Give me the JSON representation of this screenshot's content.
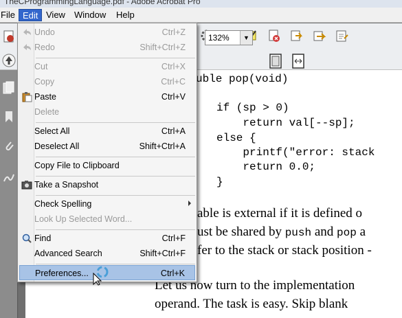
{
  "window": {
    "title": "TheCProgrammingLanguage.pdf - Adobe Acrobat Pro"
  },
  "menubar": {
    "items": [
      "File",
      "Edit",
      "View",
      "Window",
      "Help"
    ],
    "active": "Edit"
  },
  "toolbar": {
    "zoom": "132%"
  },
  "edit_menu": {
    "items": [
      {
        "label": "Undo",
        "shortcut": "Ctrl+Z",
        "enabled": false,
        "icon": "undo-icon"
      },
      {
        "label": "Redo",
        "shortcut": "Shift+Ctrl+Z",
        "enabled": false,
        "icon": "redo-icon"
      },
      {
        "label": "Cut",
        "shortcut": "Ctrl+X",
        "enabled": false
      },
      {
        "label": "Copy",
        "shortcut": "Ctrl+C",
        "enabled": false
      },
      {
        "label": "Paste",
        "shortcut": "Ctrl+V",
        "enabled": true,
        "icon": "paste-icon"
      },
      {
        "label": "Delete",
        "shortcut": "",
        "enabled": false
      },
      {
        "label": "Select All",
        "shortcut": "Ctrl+A",
        "enabled": true
      },
      {
        "label": "Deselect All",
        "shortcut": "Shift+Ctrl+A",
        "enabled": true
      },
      {
        "label": "Copy File to Clipboard",
        "shortcut": "",
        "enabled": true
      },
      {
        "label": "Take a Snapshot",
        "shortcut": "",
        "enabled": true,
        "icon": "camera-icon"
      },
      {
        "label": "Check Spelling",
        "shortcut": "",
        "enabled": true,
        "submenu": true
      },
      {
        "label": "Look Up Selected Word...",
        "shortcut": "",
        "enabled": false
      },
      {
        "label": "Find",
        "shortcut": "Ctrl+F",
        "enabled": true,
        "icon": "search-icon"
      },
      {
        "label": "Advanced Search",
        "shortcut": "Shift+Ctrl+F",
        "enabled": true
      },
      {
        "label": "Preferences...",
        "shortcut": "Ctrl+K",
        "enabled": true,
        "highlighted": true
      }
    ]
  },
  "document": {
    "code_lines": [
      "uble pop(void)",
      "if (sp > 0)",
      "    return val[--sp];",
      "else {",
      "    printf(\"error: stack",
      "    return 0.0;",
      "}"
    ],
    "prose": {
      "line1": "able is external if it is defined o",
      "line2_a": "ust be shared by ",
      "line2_push": "push",
      "line2_b": " and ",
      "line2_pop": "pop",
      "line2_c": " a",
      "line3": "fer to the stack or stack position -",
      "line4": "Let us now turn to the implementation",
      "line5": "operand. The task is easy. Skip blank"
    }
  }
}
